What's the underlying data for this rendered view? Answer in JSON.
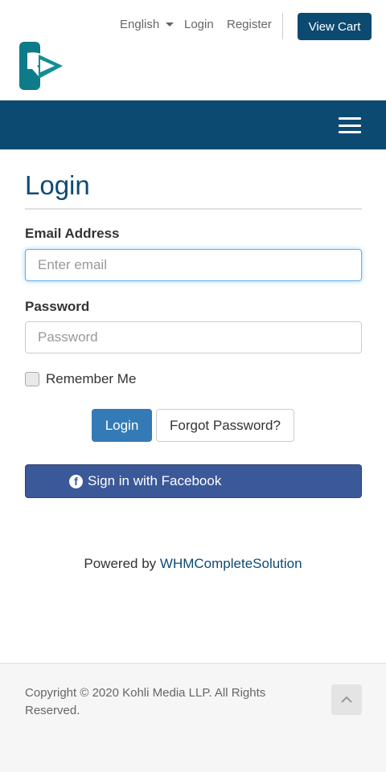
{
  "header": {
    "language_label": "English",
    "login_link": "Login",
    "register_link": "Register",
    "view_cart_label": "View Cart"
  },
  "colors": {
    "brand": "#0d4a72",
    "primary_button": "#337ab7",
    "facebook": "#3b5998"
  },
  "icons": {
    "logo": "rk-logo",
    "menu": "hamburger-icon",
    "language_dropdown": "caret-down-icon",
    "facebook": "facebook-icon",
    "back_to_top": "chevron-up-icon"
  },
  "form": {
    "title": "Login",
    "email_label": "Email Address",
    "email_placeholder": "Enter email",
    "password_label": "Password",
    "password_placeholder": "Password",
    "remember_label": "Remember Me",
    "login_button": "Login",
    "forgot_button": "Forgot Password?",
    "facebook_button": "Sign in with Facebook"
  },
  "powered": {
    "prefix": "Powered by",
    "link": "WHMCompleteSolution"
  },
  "footer": {
    "copyright": "Copyright © 2020 Kohli Media LLP. All Rights Reserved."
  }
}
